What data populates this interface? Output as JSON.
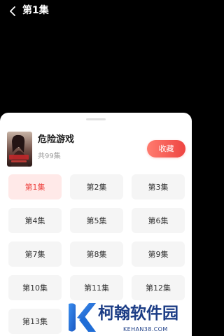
{
  "header": {
    "back_icon": "chevron-left-icon",
    "title": "第1集"
  },
  "sheet": {
    "drama": {
      "poster_icon": "drama-poster",
      "title": "危险游戏",
      "episode_count": "共99集",
      "favorite_label": "收藏"
    },
    "episodes": [
      {
        "label": "第1集",
        "selected": true
      },
      {
        "label": "第2集",
        "selected": false
      },
      {
        "label": "第3集",
        "selected": false
      },
      {
        "label": "第4集",
        "selected": false
      },
      {
        "label": "第5集",
        "selected": false
      },
      {
        "label": "第6集",
        "selected": false
      },
      {
        "label": "第7集",
        "selected": false
      },
      {
        "label": "第8集",
        "selected": false
      },
      {
        "label": "第9集",
        "selected": false
      },
      {
        "label": "第10集",
        "selected": false
      },
      {
        "label": "第11集",
        "selected": false
      },
      {
        "label": "第12集",
        "selected": false
      },
      {
        "label": "第13集",
        "selected": false
      }
    ]
  },
  "watermark": {
    "logo_icon": "k-logo-icon",
    "name": "柯翰软件园",
    "url": "KEHAN38.COM"
  },
  "colors": {
    "accent": "#ee4542",
    "accent_light": "#ff7b6f",
    "selected_bg": "#ffe9e8",
    "tile_bg": "#f5f5f5",
    "player_bg": "#000000",
    "watermark": "#1c3d86"
  }
}
